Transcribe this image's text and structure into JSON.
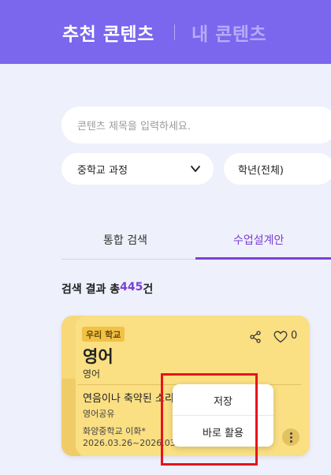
{
  "header": {
    "tab_recommended": "추천 콘텐츠",
    "tab_my": "내 콘텐츠",
    "bg_color": "#7b66ee"
  },
  "search": {
    "placeholder": "콘텐츠 제목을 입력하세요."
  },
  "filters": {
    "school": "중학교 과정",
    "grade": "학년(전체)"
  },
  "tabs": {
    "integrated": "통합 검색",
    "lesson_plan": "수업설계안",
    "active": "수업설계안"
  },
  "results": {
    "prefix": "검색 결과 총 ",
    "count": "445",
    "suffix": "건"
  },
  "card": {
    "badge": "우리 학교",
    "subject": "영어",
    "subject_sub": "영어",
    "title": "연음이나 축약된 소리",
    "author": "영어공유",
    "school": "화양중학교 이화*",
    "date": "2026.03.26~2026.03",
    "likes": "0",
    "icons": [
      "share-icon",
      "heart-icon",
      "more-icon"
    ]
  },
  "popup": {
    "save": "저장",
    "use_now": "바로 활용"
  }
}
